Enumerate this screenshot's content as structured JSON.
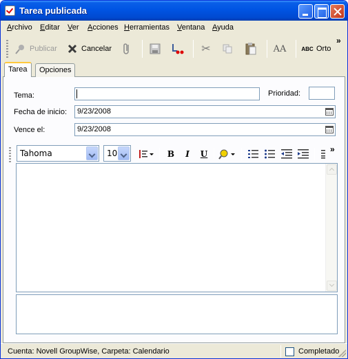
{
  "window": {
    "title": "Tarea publicada"
  },
  "menu": [
    "Archivo",
    "Editar",
    "Ver",
    "Acciones",
    "Herramientas",
    "Ventana",
    "Ayuda"
  ],
  "toolbar": {
    "publish_label": "Publicar",
    "cancel_label": "Cancelar",
    "spell_label": "Orto",
    "spell_icon_text": "ABC",
    "font_icon_text": "AA"
  },
  "tabs": [
    "Tarea",
    "Opciones"
  ],
  "form": {
    "subject_label": "Tema:",
    "subject_value": "",
    "priority_label": "Prioridad:",
    "priority_value": "",
    "start_label": "Fecha de inicio:",
    "start_value": "9/23/2008",
    "due_label": "Vence el:",
    "due_value": "9/23/2008"
  },
  "format": {
    "font_name": "Tahoma",
    "font_size": "10",
    "bold": "B",
    "italic": "I",
    "underline": "U"
  },
  "status": {
    "account_text": "Cuenta: Novell GroupWise,  Carpeta: Calendario",
    "completed_label": "Completado",
    "completed_checked": false
  }
}
